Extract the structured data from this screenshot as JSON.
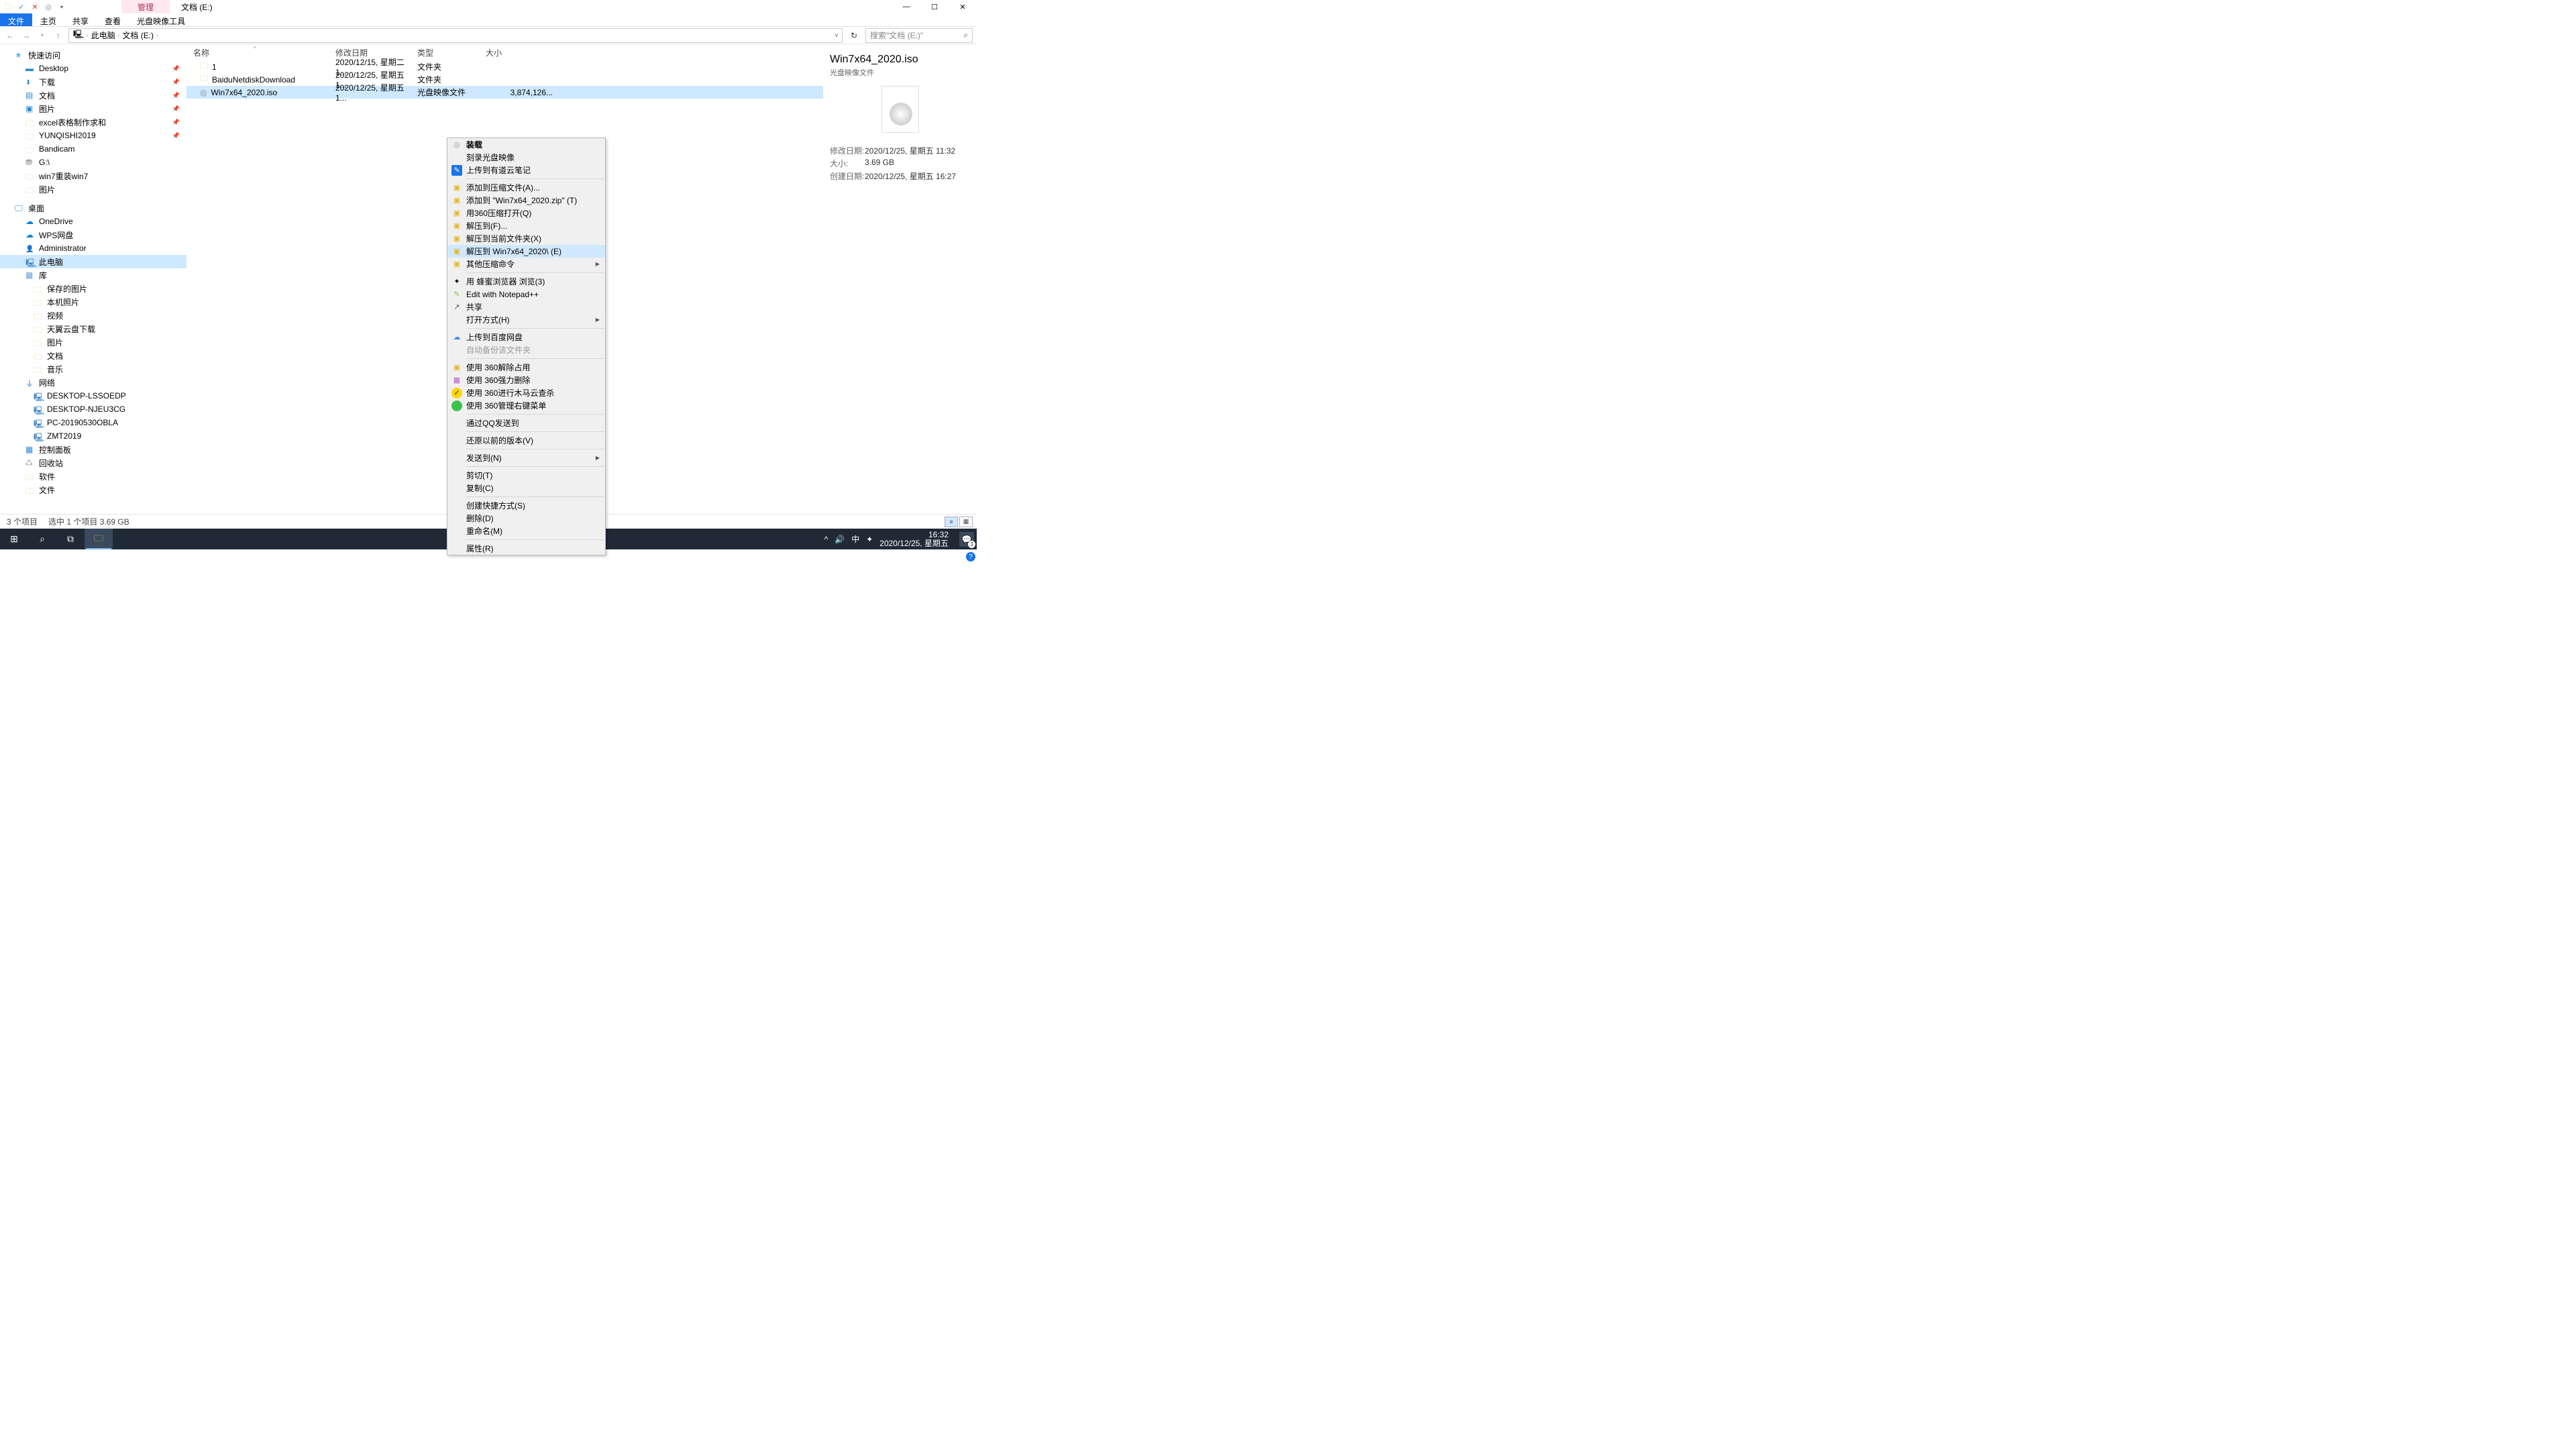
{
  "title": {
    "contextual_tab": "管理",
    "window_title": "文档 (E:)"
  },
  "qat": [
    "folder-icon",
    "check-icon",
    "close-icon",
    "mount-icon",
    "dropdown-icon"
  ],
  "win_buttons": {
    "min": "—",
    "max": "☐",
    "close": "✕"
  },
  "ribbon": {
    "tabs": [
      "文件",
      "主页",
      "共享",
      "查看",
      "光盘映像工具"
    ],
    "active": 0
  },
  "nav": {
    "back": "←",
    "fwd": "→",
    "up": "↑"
  },
  "breadcrumbs": {
    "pc_icon": "🖳",
    "items": [
      "此电脑",
      "文档 (E:)"
    ]
  },
  "search": {
    "placeholder": "搜索\"文档 (E:)\"",
    "icon": "⌕"
  },
  "tree": [
    {
      "label": "快速访问",
      "icon": "icon-star",
      "lvl": 1,
      "hdr": true
    },
    {
      "label": "Desktop",
      "icon": "icon-desktop",
      "lvl": 2,
      "pin": true
    },
    {
      "label": "下载",
      "icon": "icon-down",
      "lvl": 2,
      "pin": true
    },
    {
      "label": "文档",
      "icon": "icon-doc",
      "lvl": 2,
      "pin": true
    },
    {
      "label": "图片",
      "icon": "icon-img",
      "lvl": 2,
      "pin": true
    },
    {
      "label": "excel表格制作求和",
      "icon": "icon-folder",
      "lvl": 2,
      "pin": true
    },
    {
      "label": "YUNQISHI2019",
      "icon": "icon-folder",
      "lvl": 2,
      "pin": true
    },
    {
      "label": "Bandicam",
      "icon": "icon-folder",
      "lvl": 2
    },
    {
      "label": "G:\\",
      "icon": "icon-hdd",
      "lvl": 2
    },
    {
      "label": "win7重装win7",
      "icon": "icon-folder",
      "lvl": 2
    },
    {
      "label": "图片",
      "icon": "icon-folder",
      "lvl": 2
    },
    {
      "label": "桌面",
      "icon": "icon-monitor",
      "lvl": 1,
      "hdr": true,
      "gap": true
    },
    {
      "label": "OneDrive",
      "icon": "icon-onedrive",
      "lvl": 2
    },
    {
      "label": "WPS网盘",
      "icon": "icon-wps",
      "lvl": 2
    },
    {
      "label": "Administrator",
      "icon": "icon-user",
      "lvl": 2
    },
    {
      "label": "此电脑",
      "icon": "icon-pc",
      "lvl": 2,
      "sel": true
    },
    {
      "label": "库",
      "icon": "icon-lib",
      "lvl": 2
    },
    {
      "label": "保存的图片",
      "icon": "icon-folder",
      "lvl": 2,
      "extra": true
    },
    {
      "label": "本机照片",
      "icon": "icon-folder",
      "lvl": 2,
      "extra": true
    },
    {
      "label": "视频",
      "icon": "icon-folder",
      "lvl": 2,
      "extra": true
    },
    {
      "label": "天翼云盘下载",
      "icon": "icon-folder",
      "lvl": 2,
      "extra": true
    },
    {
      "label": "图片",
      "icon": "icon-folder",
      "lvl": 2,
      "extra": true
    },
    {
      "label": "文档",
      "icon": "icon-folder",
      "lvl": 2,
      "extra": true
    },
    {
      "label": "音乐",
      "icon": "icon-folder",
      "lvl": 2,
      "extra": true
    },
    {
      "label": "网络",
      "icon": "icon-net",
      "lvl": 2
    },
    {
      "label": "DESKTOP-LSSOEDP",
      "icon": "icon-pc",
      "lvl": 2,
      "extra": true
    },
    {
      "label": "DESKTOP-NJEU3CG",
      "icon": "icon-pc",
      "lvl": 2,
      "extra": true
    },
    {
      "label": "PC-20190530OBLA",
      "icon": "icon-pc",
      "lvl": 2,
      "extra": true
    },
    {
      "label": "ZMT2019",
      "icon": "icon-pc",
      "lvl": 2,
      "extra": true
    },
    {
      "label": "控制面板",
      "icon": "icon-panel",
      "lvl": 2
    },
    {
      "label": "回收站",
      "icon": "icon-recycle",
      "lvl": 2
    },
    {
      "label": "软件",
      "icon": "icon-folder",
      "lvl": 2
    },
    {
      "label": "文件",
      "icon": "icon-folder",
      "lvl": 2
    }
  ],
  "columns": {
    "name": "名称",
    "date": "修改日期",
    "type": "类型",
    "size": "大小",
    "sort": "^"
  },
  "rows": [
    {
      "icon": "ficon-folder",
      "glyph": "🗀",
      "name": "1",
      "date": "2020/12/15, 星期二 1...",
      "type": "文件夹",
      "size": ""
    },
    {
      "icon": "ficon-folder",
      "glyph": "🗀",
      "name": "BaiduNetdiskDownload",
      "date": "2020/12/25, 星期五 1...",
      "type": "文件夹",
      "size": ""
    },
    {
      "icon": "ficon-iso",
      "glyph": "◎",
      "name": "Win7x64_2020.iso",
      "date": "2020/12/25, 星期五 1...",
      "type": "光盘映像文件",
      "size": "3,874,126...",
      "sel": true
    }
  ],
  "ctx": [
    {
      "t": "装载",
      "icon": "ci-disc",
      "g": "◎",
      "bold": true
    },
    {
      "t": "刻录光盘映像"
    },
    {
      "t": "上传到有道云笔记",
      "icon": "ci-note",
      "g": "✎"
    },
    {
      "sep": true
    },
    {
      "t": "添加到压缩文件(A)...",
      "icon": "ci-zip",
      "g": "▣"
    },
    {
      "t": "添加到 \"Win7x64_2020.zip\" (T)",
      "icon": "ci-zip",
      "g": "▣"
    },
    {
      "t": "用360压缩打开(Q)",
      "icon": "ci-zip",
      "g": "▣"
    },
    {
      "t": "解压到(F)...",
      "icon": "ci-zip",
      "g": "▣"
    },
    {
      "t": "解压到当前文件夹(X)",
      "icon": "ci-zip",
      "g": "▣"
    },
    {
      "t": "解压到 Win7x64_2020\\ (E)",
      "icon": "ci-zip",
      "g": "▣",
      "hover": true
    },
    {
      "t": "其他压缩命令",
      "icon": "ci-zip",
      "g": "▣",
      "sub": true
    },
    {
      "sep": true
    },
    {
      "t": "用 蜂蜜浏览器 浏览(3)",
      "icon": "",
      "g": "✦"
    },
    {
      "t": "Edit with Notepad++",
      "icon": "ci-np",
      "g": "✎"
    },
    {
      "t": "共享",
      "icon": "ci-sh",
      "g": "↗"
    },
    {
      "t": "打开方式(H)",
      "sub": true
    },
    {
      "sep": true
    },
    {
      "t": "上传到百度网盘",
      "icon": "ci-bd",
      "g": "☁"
    },
    {
      "t": "自动备份该文件夹",
      "disabled": true
    },
    {
      "sep": true
    },
    {
      "t": "使用 360解除占用",
      "icon": "ci-zip",
      "g": "▣"
    },
    {
      "t": "使用 360强力删除",
      "icon": "ci-360p",
      "g": "▦"
    },
    {
      "t": "使用 360进行木马云查杀",
      "icon": "ci-360y",
      "g": "✓"
    },
    {
      "t": "使用 360管理右键菜单",
      "icon": "ci-360g",
      "g": " "
    },
    {
      "sep": true
    },
    {
      "t": "通过QQ发送到"
    },
    {
      "sep": true
    },
    {
      "t": "还原以前的版本(V)"
    },
    {
      "sep": true
    },
    {
      "t": "发送到(N)",
      "sub": true
    },
    {
      "sep": true
    },
    {
      "t": "剪切(T)"
    },
    {
      "t": "复制(C)"
    },
    {
      "sep": true
    },
    {
      "t": "创建快捷方式(S)"
    },
    {
      "t": "删除(D)"
    },
    {
      "t": "重命名(M)"
    },
    {
      "sep": true
    },
    {
      "t": "属性(R)"
    }
  ],
  "details": {
    "title": "Win7x64_2020.iso",
    "subtitle": "光盘映像文件",
    "rows": [
      {
        "label": "修改日期:",
        "val": "2020/12/25, 星期五 11:32"
      },
      {
        "label": "大小:",
        "val": "3.69 GB"
      },
      {
        "label": "创建日期:",
        "val": "2020/12/25, 星期五 16:27"
      }
    ]
  },
  "status": {
    "count": "3 个项目",
    "sel": "选中 1 个项目  3.69 GB"
  },
  "taskbar": {
    "start": "⊞",
    "search": "⌕",
    "tasks": "⧉",
    "explorer": "🗀",
    "tray": {
      "up": "^",
      "vol": "🔊",
      "ime": "中",
      "net": "✦",
      "action": "💬",
      "badge": "3"
    },
    "clock": {
      "time": "16:32",
      "date": "2020/12/25, 星期五"
    }
  }
}
